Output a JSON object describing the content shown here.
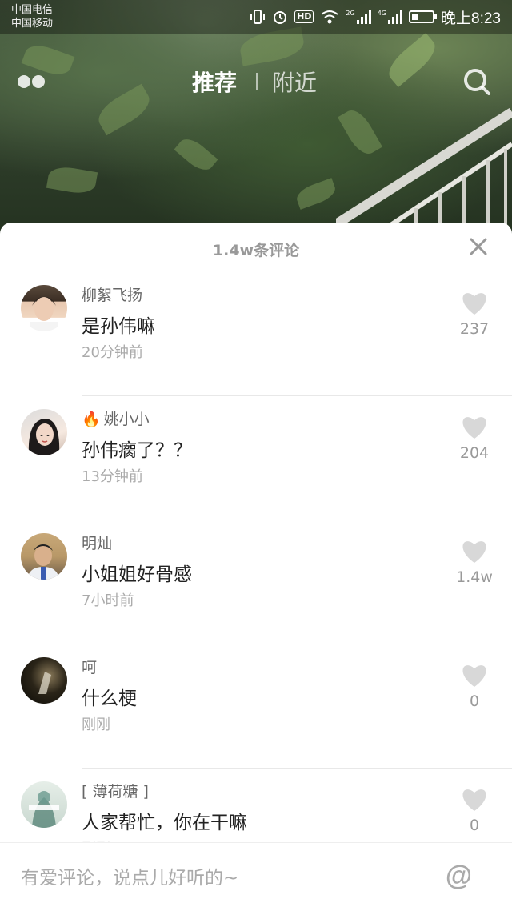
{
  "status_bar": {
    "carrier_1": "中国电信",
    "carrier_2": "中国移动",
    "hd_badge": "HD",
    "net_1": "2G",
    "net_2": "4G",
    "time": "晚上8:23",
    "battery_level": 0.3
  },
  "top_nav": {
    "tab_recommend": "推荐",
    "tab_nearby": "附近"
  },
  "comments_panel": {
    "count_label": "1.4w条评论",
    "comments": [
      {
        "user": "柳絮飞扬",
        "text": "是孙伟嘛",
        "time": "20分钟前",
        "likes": "237",
        "flame": false
      },
      {
        "user": "姚小小",
        "text": "孙伟瘸了？？",
        "time": "13分钟前",
        "likes": "204",
        "flame": true
      },
      {
        "user": "明灿",
        "text": "小姐姐好骨感",
        "time": "7小时前",
        "likes": "1.4w",
        "flame": false
      },
      {
        "user": "呵",
        "text": "什么梗",
        "time": "刚刚",
        "likes": "0",
        "flame": false
      },
      {
        "user": "[    薄荷糖 ]",
        "text": "人家帮忙，你在干嘛",
        "time": "刚刚",
        "likes": "0",
        "flame": false
      }
    ]
  },
  "input_bar": {
    "placeholder": "有爱评论，说点儿好听的~",
    "mention_symbol": "@"
  },
  "colors": {
    "sheet_bg": "#ffffff",
    "muted_text": "#999999",
    "flame": "#ff5a1f"
  }
}
